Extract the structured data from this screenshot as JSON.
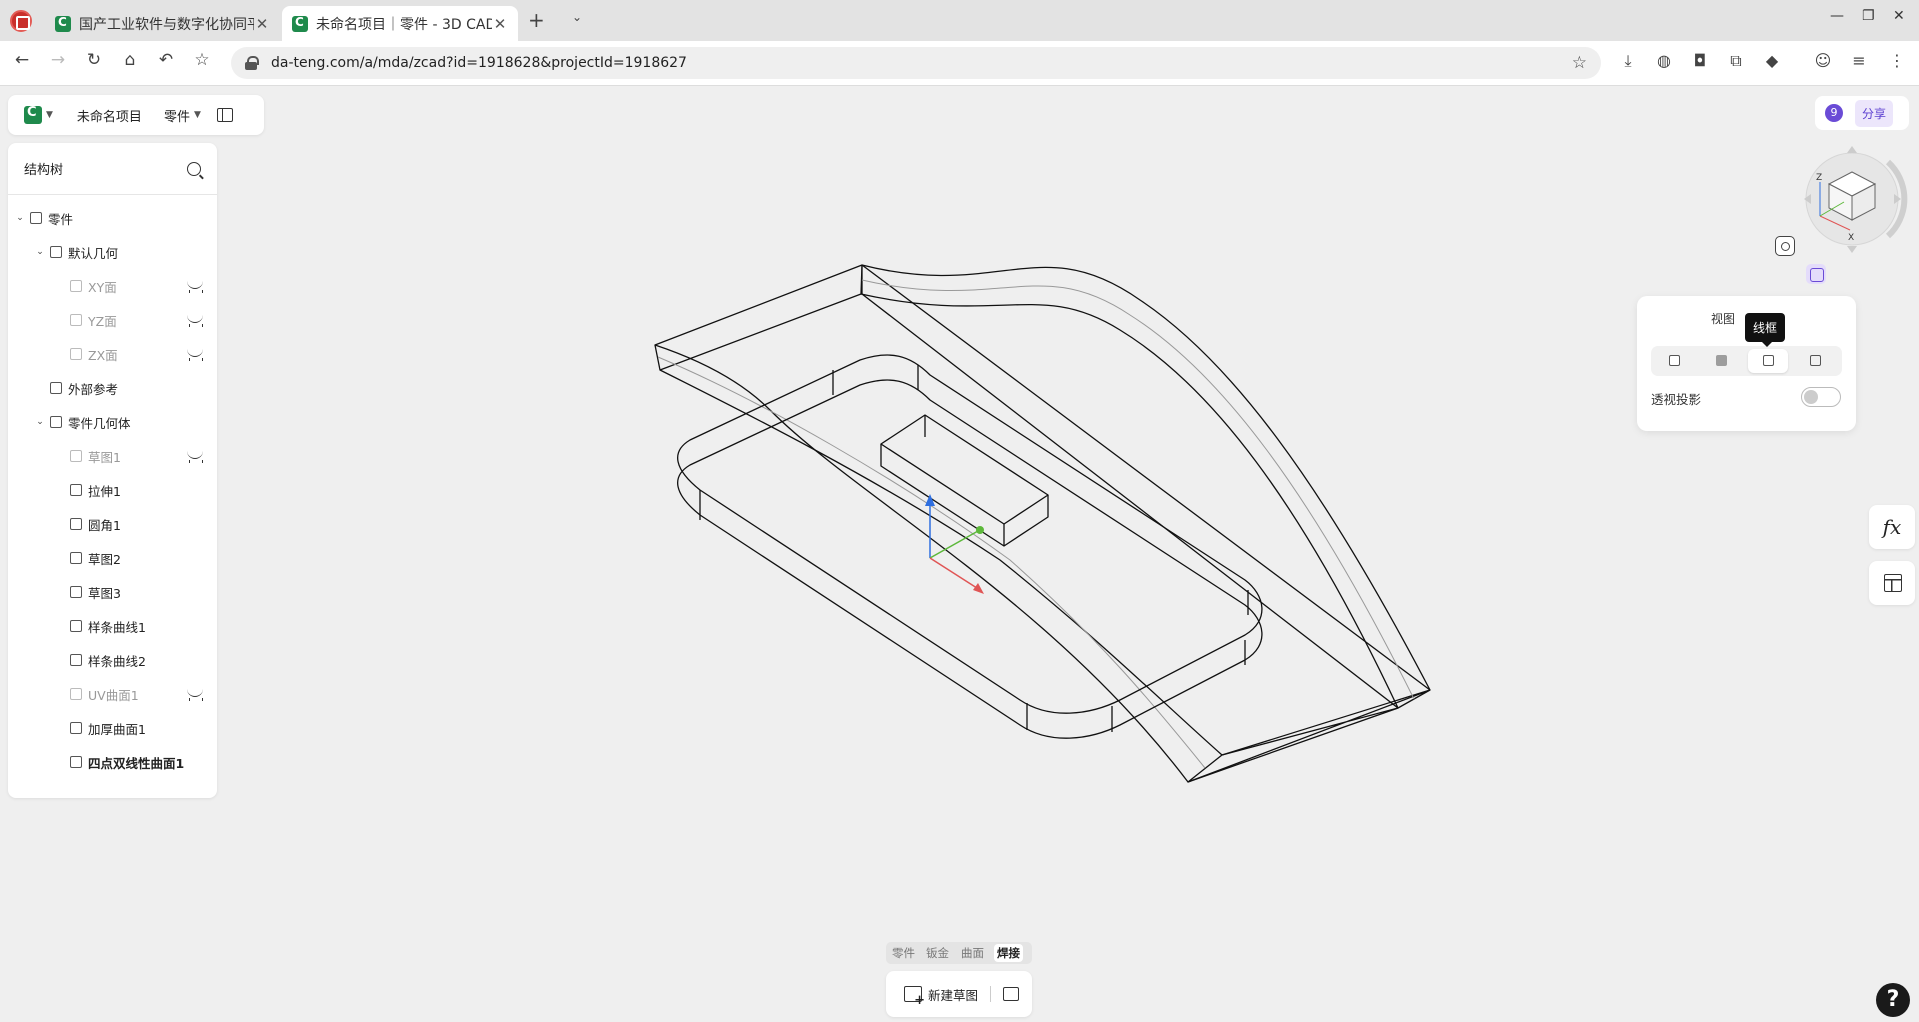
{
  "browser": {
    "tabs": [
      {
        "title": "国产工业软件与数字化协同平",
        "active": false
      },
      {
        "title": "未命名项目｜零件 - 3D CAD",
        "active": true
      }
    ],
    "url": "da-teng.com/a/mda/zcad?id=1918628&projectId=1918627",
    "icons": [
      "back-icon",
      "forward-icon",
      "reload-icon",
      "home-icon",
      "undo-icon",
      "star-icon",
      "download-icon",
      "globe-icon",
      "camera-icon",
      "extensions-icon",
      "ai-icon",
      "profile-icon",
      "settings-icon",
      "menu-icon"
    ]
  },
  "app": {
    "project_name": "未命名项目",
    "part_selector": "零件",
    "tree": {
      "title": "结构树",
      "items": [
        {
          "label": "零件",
          "level": 0,
          "expanded": true,
          "hidden": false
        },
        {
          "label": "默认几何",
          "level": 1,
          "expanded": true,
          "hidden": false
        },
        {
          "label": "XY面",
          "level": 2,
          "hidden": true
        },
        {
          "label": "YZ面",
          "level": 2,
          "hidden": true
        },
        {
          "label": "ZX面",
          "level": 2,
          "hidden": true
        },
        {
          "label": "外部参考",
          "level": 1,
          "hidden": false
        },
        {
          "label": "零件几何体",
          "level": 1,
          "expanded": true,
          "hidden": false
        },
        {
          "label": "草图1",
          "level": 2,
          "hidden": true
        },
        {
          "label": "拉伸1",
          "level": 2,
          "hidden": false
        },
        {
          "label": "圆角1",
          "level": 2,
          "hidden": false
        },
        {
          "label": "草图2",
          "level": 2,
          "hidden": false
        },
        {
          "label": "草图3",
          "level": 2,
          "hidden": false
        },
        {
          "label": "样条曲线1",
          "level": 2,
          "hidden": false
        },
        {
          "label": "样条曲线2",
          "level": 2,
          "hidden": false
        },
        {
          "label": "UV曲面1",
          "level": 2,
          "hidden": true
        },
        {
          "label": "加厚曲面1",
          "level": 2,
          "hidden": false
        },
        {
          "label": "四点双线性曲面1",
          "level": 2,
          "hidden": false,
          "bold": true
        }
      ]
    },
    "notification_count": "9",
    "share_label": "分享",
    "display_panel": {
      "tab_view": "视图",
      "tooltip": "线框",
      "shade_modes": [
        "shaded-edges",
        "shaded",
        "wireframe",
        "hidden-line"
      ],
      "active_mode": "wireframe",
      "perspective_label": "透视投影",
      "perspective_on": false
    },
    "view_cube_axes": {
      "z": "Z",
      "x": "X"
    },
    "side_tools": {
      "fx": "fx"
    },
    "bottom_tabs": [
      "零件",
      "钣金",
      "曲面",
      "焊接"
    ],
    "bottom_active": "焊接",
    "new_sketch_label": "新建草图",
    "help": "?"
  },
  "colors": {
    "accent": "#6a4bd6",
    "brand": "#1f8a4c",
    "axis_x": "#e05555",
    "axis_y": "#5cb83a",
    "axis_z": "#2f6fe0"
  }
}
